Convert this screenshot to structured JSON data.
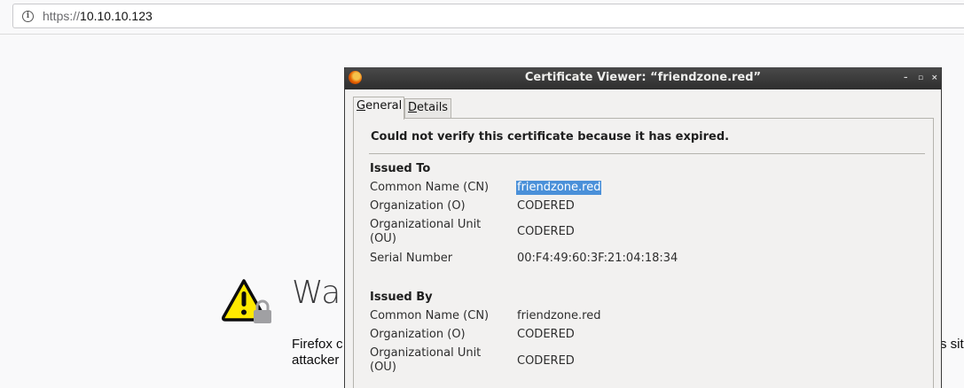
{
  "browser": {
    "url_scheme": "https://",
    "url_host": "10.10.10.123"
  },
  "page": {
    "warning_title": "War",
    "body_line1": "Firefox c",
    "body_line2": "attacker",
    "body_right": "s sit"
  },
  "dialog": {
    "title": "Certificate Viewer: “friendzone.red”",
    "window_buttons": [
      "–",
      "▫",
      "×"
    ],
    "tabs": [
      {
        "label_underlined": "G",
        "label_rest": "eneral"
      },
      {
        "label_underlined": "D",
        "label_rest": "etails"
      }
    ],
    "headline": "Could not verify this certificate because it has expired.",
    "issued_to": {
      "heading": "Issued To",
      "rows": [
        {
          "label": "Common Name (CN)",
          "value": "friendzone.red"
        },
        {
          "label": "Organization (O)",
          "value": "CODERED"
        },
        {
          "label": "Organizational Unit (OU)",
          "value": "CODERED"
        },
        {
          "label": "Serial Number",
          "value": "00:F4:49:60:3F:21:04:18:34"
        }
      ]
    },
    "issued_by": {
      "heading": "Issued By",
      "rows": [
        {
          "label": "Common Name (CN)",
          "value": "friendzone.red"
        },
        {
          "label": "Organization (O)",
          "value": "CODERED"
        },
        {
          "label": "Organizational Unit (OU)",
          "value": "CODERED"
        }
      ]
    }
  },
  "colors": {
    "selection": "#4a90d9",
    "warning_yellow": "#ffe900",
    "titlebar": "#2e2e2e"
  }
}
